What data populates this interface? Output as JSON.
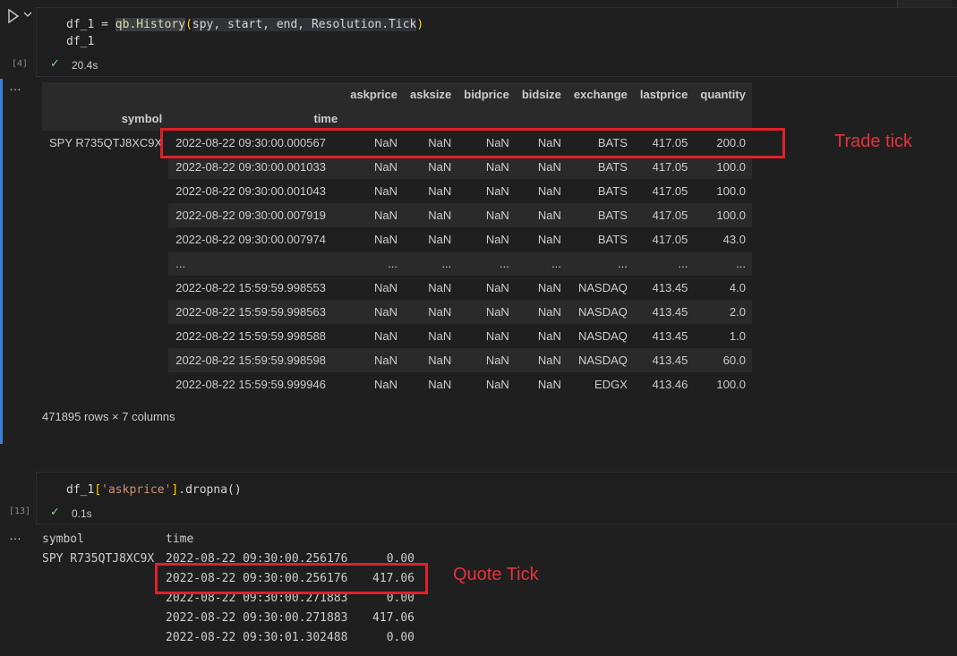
{
  "cell1": {
    "code_line1_pre": "df_1 = ",
    "code_line1_fn": "qb.History",
    "code_line1_open": "(",
    "code_line1_args": "spy, start, end, Resolution.Tick",
    "code_line1_close": ")",
    "code_line2": "df_1",
    "exec_count": "[4]",
    "duration": "20.4s",
    "output_ellipsis": "…"
  },
  "dataframe": {
    "columns": [
      "askprice",
      "asksize",
      "bidprice",
      "bidsize",
      "exchange",
      "lastprice",
      "quantity"
    ],
    "index_names": [
      "symbol",
      "time"
    ],
    "symbol": "SPY R735QTJ8XC9X",
    "rows": [
      [
        "2022-08-22 09:30:00.000567",
        "NaN",
        "NaN",
        "NaN",
        "NaN",
        "BATS",
        "417.05",
        "200.0"
      ],
      [
        "2022-08-22 09:30:00.001033",
        "NaN",
        "NaN",
        "NaN",
        "NaN",
        "BATS",
        "417.05",
        "100.0"
      ],
      [
        "2022-08-22 09:30:00.001043",
        "NaN",
        "NaN",
        "NaN",
        "NaN",
        "BATS",
        "417.05",
        "100.0"
      ],
      [
        "2022-08-22 09:30:00.007919",
        "NaN",
        "NaN",
        "NaN",
        "NaN",
        "BATS",
        "417.05",
        "100.0"
      ],
      [
        "2022-08-22 09:30:00.007974",
        "NaN",
        "NaN",
        "NaN",
        "NaN",
        "BATS",
        "417.05",
        "43.0"
      ],
      [
        "...",
        "...",
        "...",
        "...",
        "...",
        "...",
        "...",
        "..."
      ],
      [
        "2022-08-22 15:59:59.998553",
        "NaN",
        "NaN",
        "NaN",
        "NaN",
        "NASDAQ",
        "413.45",
        "4.0"
      ],
      [
        "2022-08-22 15:59:59.998563",
        "NaN",
        "NaN",
        "NaN",
        "NaN",
        "NASDAQ",
        "413.45",
        "2.0"
      ],
      [
        "2022-08-22 15:59:59.998588",
        "NaN",
        "NaN",
        "NaN",
        "NaN",
        "NASDAQ",
        "413.45",
        "1.0"
      ],
      [
        "2022-08-22 15:59:59.998598",
        "NaN",
        "NaN",
        "NaN",
        "NaN",
        "NASDAQ",
        "413.45",
        "60.0"
      ],
      [
        "2022-08-22 15:59:59.999946",
        "NaN",
        "NaN",
        "NaN",
        "NaN",
        "EDGX",
        "413.46",
        "100.0"
      ]
    ],
    "shape_text": "471895 rows × 7 columns"
  },
  "annotations": {
    "trade_label": "Trade tick",
    "quote_label": "Quote Tick",
    "color": "#e0202a"
  },
  "cell2": {
    "code_pre": "df_1",
    "code_open": "[",
    "code_str": "'askprice'",
    "code_close": "]",
    "code_post": ".dropna()",
    "exec_count": "[13]",
    "duration": "0.1s",
    "output_ellipsis": "…"
  },
  "series": {
    "header_symbol": "symbol",
    "header_time": "time",
    "symbol": "SPY R735QTJ8XC9X",
    "rows": [
      {
        "time": "2022-08-22 09:30:00.256176",
        "value": "0.00"
      },
      {
        "time": "2022-08-22 09:30:00.256176",
        "value": "417.06"
      },
      {
        "time": "2022-08-22 09:30:00.271883",
        "value": "0.00"
      },
      {
        "time": "2022-08-22 09:30:00.271883",
        "value": "417.06"
      },
      {
        "time": "2022-08-22 09:30:01.302488",
        "value": "0.00"
      }
    ]
  }
}
